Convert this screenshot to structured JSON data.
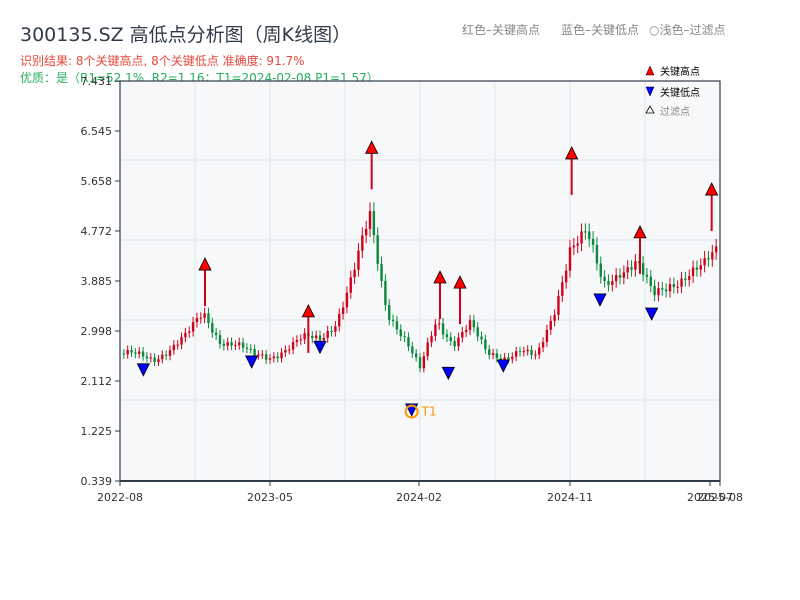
{
  "header": {
    "title": "300135.SZ 高低点分析图（周K线图）",
    "result": "识别结果: 8个关键高点, 8个关键低点  准确度: 91.7%",
    "quality": "优质：是（R1=52.1%, R2=1.16；T1=2024-02-08 P1=1.57）",
    "legend_red": "红色–关键高点",
    "legend_blue": "蓝色–关键低点",
    "legend_light": "○浅色–过滤点"
  },
  "colors": {
    "up": "#d0021b",
    "down": "#0a8a3a",
    "high_marker": "#ff0000",
    "low_marker": "#0000ff",
    "t1": "#ff9900",
    "axis": "#2f3b4a",
    "plot_bg": "#f6f8fa"
  },
  "chart_data": {
    "type": "candlestick",
    "ylim": [
      0.339,
      7.431
    ],
    "yticks": [
      "0.339",
      "1.225",
      "2.112",
      "2.998",
      "3.885",
      "4.772",
      "5.658",
      "6.545",
      "7.431"
    ],
    "xticks": [
      "2022-08",
      "2023-05",
      "2024-02",
      "2024-11",
      "2025-07",
      "2025-08"
    ],
    "grid": true,
    "monthly_close": {
      "start": "2022-08",
      "values": [
        2.6,
        2.55,
        2.5,
        2.7,
        2.9,
        3.3,
        2.85,
        2.75,
        2.55,
        2.55,
        2.7,
        2.85,
        2.85,
        3.2,
        4.0,
        5.0,
        3.4,
        2.9,
        2.3,
        3.2,
        2.8,
        3.1,
        2.6,
        2.55,
        2.65,
        2.5,
        3.3,
        4.5,
        4.7,
        3.8,
        4.1,
        4.2,
        3.6,
        3.85,
        4.0,
        4.1,
        4.5
      ]
    },
    "key_highs": [
      {
        "month": 5.1,
        "price": 4.15
      },
      {
        "month": 11.3,
        "price": 3.32
      },
      {
        "month": 15.1,
        "price": 6.22
      },
      {
        "month": 19.2,
        "price": 3.92
      },
      {
        "month": 20.4,
        "price": 3.83
      },
      {
        "month": 27.1,
        "price": 6.12
      },
      {
        "month": 31.2,
        "price": 4.72
      },
      {
        "month": 35.5,
        "price": 5.48
      }
    ],
    "key_lows": [
      {
        "month": 1.4,
        "price": 2.31
      },
      {
        "month": 7.9,
        "price": 2.45
      },
      {
        "month": 12.0,
        "price": 2.71
      },
      {
        "month": 17.5,
        "price": 1.6
      },
      {
        "month": 19.7,
        "price": 2.25
      },
      {
        "month": 23.0,
        "price": 2.38
      },
      {
        "month": 28.8,
        "price": 3.55
      },
      {
        "month": 31.9,
        "price": 3.3
      }
    ],
    "t1": {
      "label": "T1",
      "date": "2024-02-08",
      "price": 1.57
    },
    "legend": {
      "position": "top-right",
      "items": [
        "关键高点",
        "关键低点",
        "过滤点"
      ]
    }
  }
}
